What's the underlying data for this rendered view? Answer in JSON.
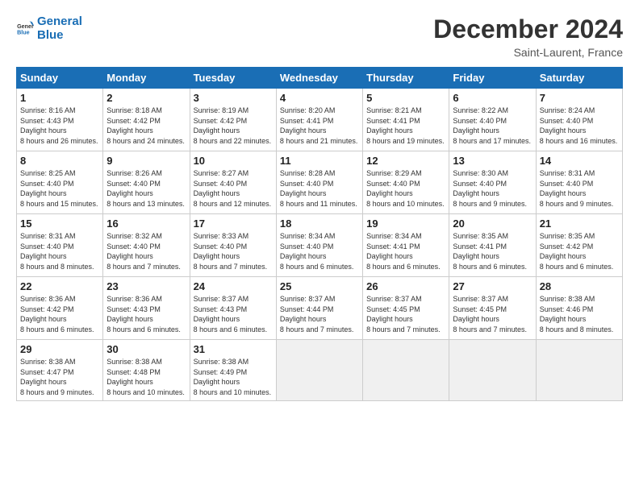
{
  "header": {
    "logo_general": "General",
    "logo_blue": "Blue",
    "month_title": "December 2024",
    "location": "Saint-Laurent, France"
  },
  "weekdays": [
    "Sunday",
    "Monday",
    "Tuesday",
    "Wednesday",
    "Thursday",
    "Friday",
    "Saturday"
  ],
  "weeks": [
    [
      {
        "day": "1",
        "sunrise": "8:16 AM",
        "sunset": "4:43 PM",
        "daylight": "8 hours and 26 minutes."
      },
      {
        "day": "2",
        "sunrise": "8:18 AM",
        "sunset": "4:42 PM",
        "daylight": "8 hours and 24 minutes."
      },
      {
        "day": "3",
        "sunrise": "8:19 AM",
        "sunset": "4:42 PM",
        "daylight": "8 hours and 22 minutes."
      },
      {
        "day": "4",
        "sunrise": "8:20 AM",
        "sunset": "4:41 PM",
        "daylight": "8 hours and 21 minutes."
      },
      {
        "day": "5",
        "sunrise": "8:21 AM",
        "sunset": "4:41 PM",
        "daylight": "8 hours and 19 minutes."
      },
      {
        "day": "6",
        "sunrise": "8:22 AM",
        "sunset": "4:40 PM",
        "daylight": "8 hours and 17 minutes."
      },
      {
        "day": "7",
        "sunrise": "8:24 AM",
        "sunset": "4:40 PM",
        "daylight": "8 hours and 16 minutes."
      }
    ],
    [
      {
        "day": "8",
        "sunrise": "8:25 AM",
        "sunset": "4:40 PM",
        "daylight": "8 hours and 15 minutes."
      },
      {
        "day": "9",
        "sunrise": "8:26 AM",
        "sunset": "4:40 PM",
        "daylight": "8 hours and 13 minutes."
      },
      {
        "day": "10",
        "sunrise": "8:27 AM",
        "sunset": "4:40 PM",
        "daylight": "8 hours and 12 minutes."
      },
      {
        "day": "11",
        "sunrise": "8:28 AM",
        "sunset": "4:40 PM",
        "daylight": "8 hours and 11 minutes."
      },
      {
        "day": "12",
        "sunrise": "8:29 AM",
        "sunset": "4:40 PM",
        "daylight": "8 hours and 10 minutes."
      },
      {
        "day": "13",
        "sunrise": "8:30 AM",
        "sunset": "4:40 PM",
        "daylight": "8 hours and 9 minutes."
      },
      {
        "day": "14",
        "sunrise": "8:31 AM",
        "sunset": "4:40 PM",
        "daylight": "8 hours and 9 minutes."
      }
    ],
    [
      {
        "day": "15",
        "sunrise": "8:31 AM",
        "sunset": "4:40 PM",
        "daylight": "8 hours and 8 minutes."
      },
      {
        "day": "16",
        "sunrise": "8:32 AM",
        "sunset": "4:40 PM",
        "daylight": "8 hours and 7 minutes."
      },
      {
        "day": "17",
        "sunrise": "8:33 AM",
        "sunset": "4:40 PM",
        "daylight": "8 hours and 7 minutes."
      },
      {
        "day": "18",
        "sunrise": "8:34 AM",
        "sunset": "4:40 PM",
        "daylight": "8 hours and 6 minutes."
      },
      {
        "day": "19",
        "sunrise": "8:34 AM",
        "sunset": "4:41 PM",
        "daylight": "8 hours and 6 minutes."
      },
      {
        "day": "20",
        "sunrise": "8:35 AM",
        "sunset": "4:41 PM",
        "daylight": "8 hours and 6 minutes."
      },
      {
        "day": "21",
        "sunrise": "8:35 AM",
        "sunset": "4:42 PM",
        "daylight": "8 hours and 6 minutes."
      }
    ],
    [
      {
        "day": "22",
        "sunrise": "8:36 AM",
        "sunset": "4:42 PM",
        "daylight": "8 hours and 6 minutes."
      },
      {
        "day": "23",
        "sunrise": "8:36 AM",
        "sunset": "4:43 PM",
        "daylight": "8 hours and 6 minutes."
      },
      {
        "day": "24",
        "sunrise": "8:37 AM",
        "sunset": "4:43 PM",
        "daylight": "8 hours and 6 minutes."
      },
      {
        "day": "25",
        "sunrise": "8:37 AM",
        "sunset": "4:44 PM",
        "daylight": "8 hours and 7 minutes."
      },
      {
        "day": "26",
        "sunrise": "8:37 AM",
        "sunset": "4:45 PM",
        "daylight": "8 hours and 7 minutes."
      },
      {
        "day": "27",
        "sunrise": "8:37 AM",
        "sunset": "4:45 PM",
        "daylight": "8 hours and 7 minutes."
      },
      {
        "day": "28",
        "sunrise": "8:38 AM",
        "sunset": "4:46 PM",
        "daylight": "8 hours and 8 minutes."
      }
    ],
    [
      {
        "day": "29",
        "sunrise": "8:38 AM",
        "sunset": "4:47 PM",
        "daylight": "8 hours and 9 minutes."
      },
      {
        "day": "30",
        "sunrise": "8:38 AM",
        "sunset": "4:48 PM",
        "daylight": "8 hours and 10 minutes."
      },
      {
        "day": "31",
        "sunrise": "8:38 AM",
        "sunset": "4:49 PM",
        "daylight": "8 hours and 10 minutes."
      },
      null,
      null,
      null,
      null
    ]
  ]
}
